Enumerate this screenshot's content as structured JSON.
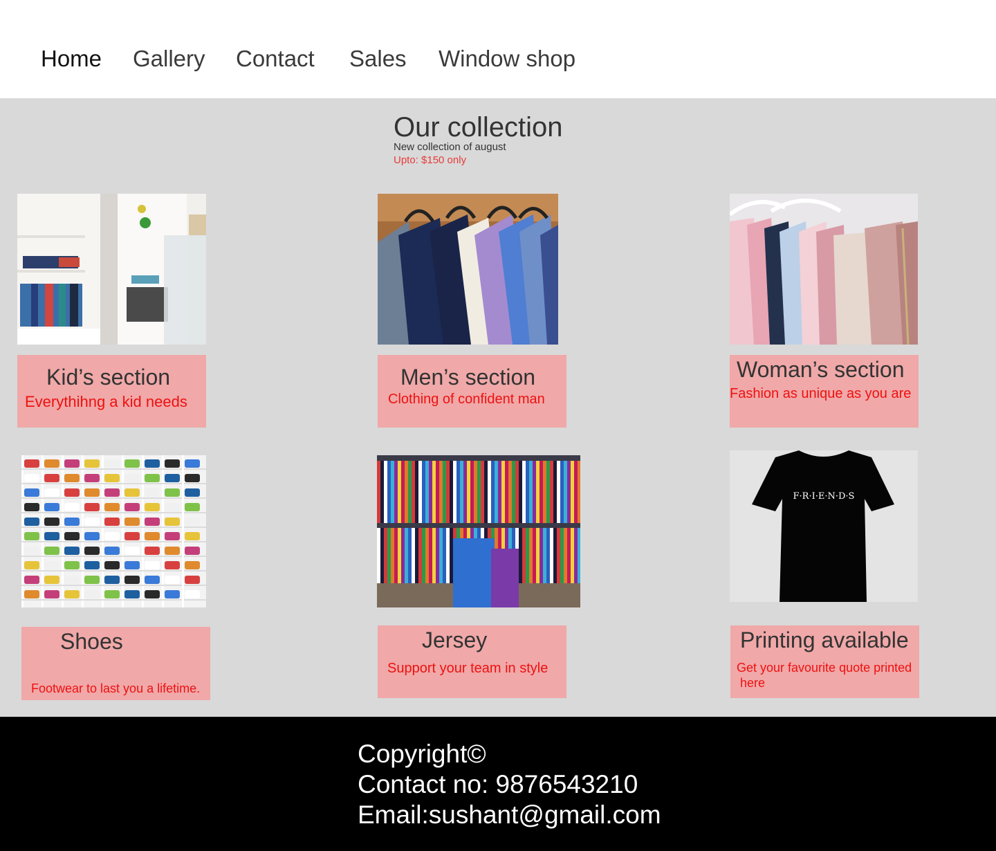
{
  "nav": {
    "items": [
      "Home",
      "Gallery",
      "Contact",
      "Sales",
      "Window shop"
    ]
  },
  "collection": {
    "title": "Our collection",
    "subtitle": "New collection of august",
    "price": "Upto: $150 only"
  },
  "sections": [
    {
      "title": "Kid’s section",
      "desc": "Everythihng a kid needs",
      "image": "kids-store-image"
    },
    {
      "title": "Men’s section",
      "desc": "Clothing of confident man",
      "image": "mens-shirts-image"
    },
    {
      "title": "Woman’s section",
      "desc": "Fashion as unique as you are",
      "image": "womens-clothes-image"
    },
    {
      "title": "Shoes",
      "desc": "Footwear to last you a lifetime.",
      "image": "shoes-shelf-image"
    },
    {
      "title": "Jersey",
      "desc": "Support your team in style",
      "image": "jersey-rack-image"
    },
    {
      "title": "Printing available",
      "desc": "Get your favourite quote printed",
      "desc2": "here",
      "image": "printed-tshirt-image",
      "print_text": "F·R·I·E·N·D·S"
    }
  ],
  "footer": {
    "copyright": "Copyright©",
    "contact": "Contact no: 9876543210",
    "email": "Email:sushant@gmail.com"
  },
  "colors": {
    "card": "#f0a8a8",
    "accent_red": "#ee1111",
    "main_bg": "#d9d9d9",
    "footer_bg": "#000000"
  }
}
